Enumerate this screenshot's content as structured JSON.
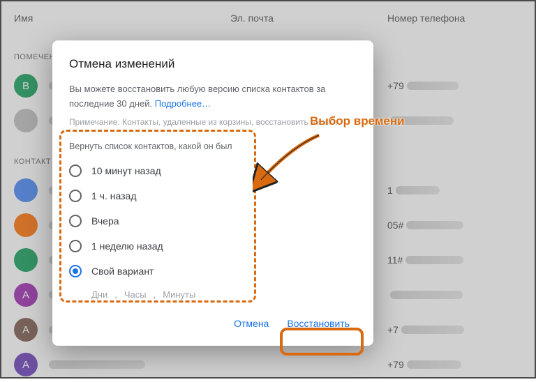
{
  "header": {
    "name": "Имя",
    "email": "Эл. почта",
    "phone": "Номер телефона"
  },
  "sections": {
    "starred": "ПОМЕЧЕН",
    "contacts": "КОНТАКТ"
  },
  "contacts": [
    {
      "initial": "В",
      "color": "#0f9d58",
      "phone_prefix": "+79"
    },
    {
      "initial": "",
      "color": "#bdbdbd",
      "phone_prefix": ""
    },
    {
      "initial": "",
      "color": "#4285f4",
      "phone_prefix": "1"
    },
    {
      "initial": "",
      "color": "#ff6d00",
      "phone_prefix": "05#"
    },
    {
      "initial": "",
      "color": "#0f9d58",
      "phone_prefix": "11#"
    },
    {
      "initial": "А",
      "color": "#9c27b0",
      "phone_prefix": ""
    },
    {
      "initial": "А",
      "color": "#795548",
      "phone_prefix": "+7"
    },
    {
      "initial": "А",
      "color": "#673ab7",
      "phone_prefix": "+79"
    }
  ],
  "dialog": {
    "title": "Отмена изменений",
    "body_prefix": "Вы можете восстановить любую версию списка контактов за последние 30 дней. ",
    "more_link": "Подробнее…",
    "note": "Примечание. Контакты, удаленные из корзины, восстановить нельзя",
    "group_label": "Вернуть список контактов, какой он был",
    "options": [
      "10 минут назад",
      "1 ч. назад",
      "Вчера",
      "1 неделю назад",
      "Свой вариант"
    ],
    "selected_index": 4,
    "custom_units": {
      "days": "Дни",
      "hours": "Часы",
      "minutes": "Минуты",
      "sep": ","
    },
    "cancel": "Отмена",
    "restore": "Восстановить"
  },
  "annotation": {
    "time_label": "Выбор времени"
  }
}
